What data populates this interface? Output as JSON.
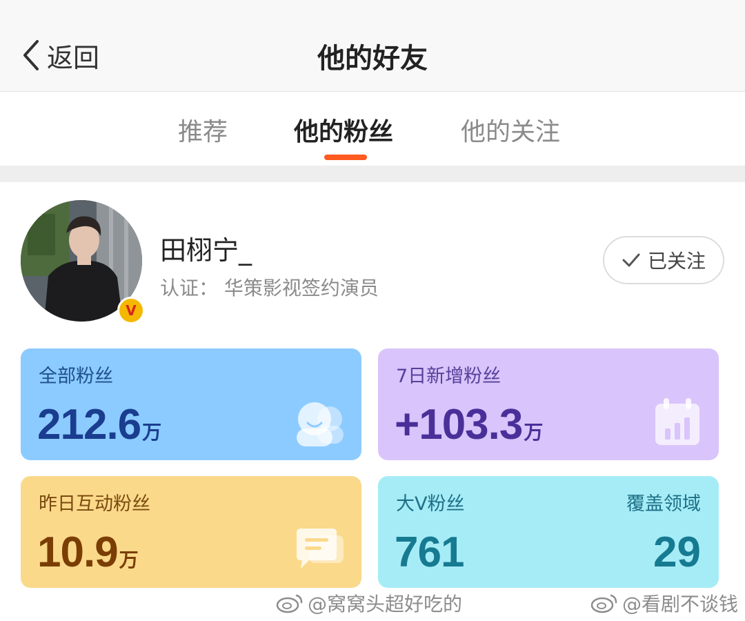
{
  "header": {
    "back_label": "返回",
    "title": "他的好友"
  },
  "tabs": [
    {
      "label": "推荐",
      "active": false
    },
    {
      "label": "他的粉丝",
      "active": true
    },
    {
      "label": "他的关注",
      "active": false
    }
  ],
  "colors": {
    "accent": "#ff5a1f",
    "card_all": "#8ccbff",
    "card_new": "#d9c4fb",
    "card_interact": "#fbd98a",
    "card_bigv": "#a6ecf7"
  },
  "profile": {
    "name": "田栩宁_",
    "certification": "认证：  华策影视签约演员",
    "verified_badge": "V",
    "follow_label": "已关注"
  },
  "stats": {
    "all_fans": {
      "label": "全部粉丝",
      "value": "212.6",
      "unit": "万",
      "icon": "fans-icon"
    },
    "new_fans": {
      "label": "7日新增粉丝",
      "value": "+103.3",
      "unit": "万",
      "icon": "calendar-chart-icon"
    },
    "interactive_fans": {
      "label": "昨日互动粉丝",
      "value": "10.9",
      "unit": "万",
      "icon": "chat-icon"
    },
    "bigv_fans": {
      "label": "大V粉丝",
      "value": "761",
      "coverage_label": "覆盖领域",
      "coverage_value": "29"
    }
  },
  "watermarks": [
    "@窝窝头超好吃的",
    "@看剧不谈钱"
  ]
}
